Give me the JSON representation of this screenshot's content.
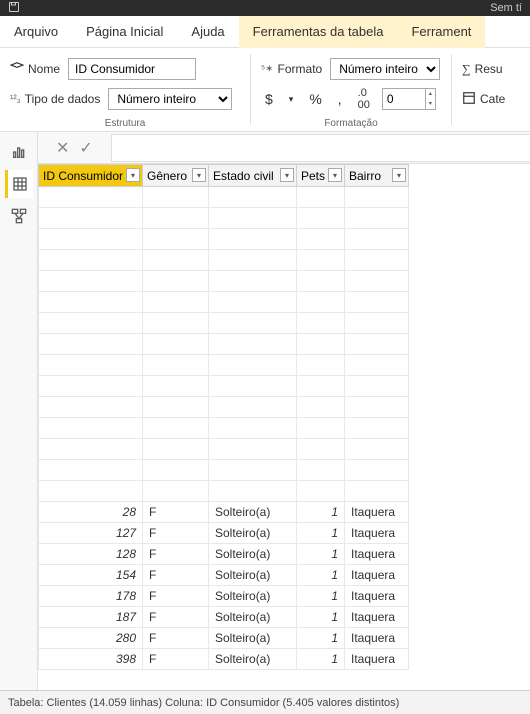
{
  "titlebar": {
    "right_text": "Sem tí"
  },
  "tabs": {
    "file": "Arquivo",
    "home": "Página Inicial",
    "help": "Ajuda",
    "table_tools": "Ferramentas da tabela",
    "col_tools": "Ferrament"
  },
  "ribbon": {
    "name_label": "Nome",
    "name_value": "ID Consumidor",
    "datatype_label": "Tipo de dados",
    "datatype_value": "Número inteiro",
    "structure_group": "Estrutura",
    "format_label": "Formato",
    "format_value": "Número inteiro",
    "decimal_value": "0",
    "format_group": "Formatação",
    "sum_label": "Resu",
    "cat_label": "Cate",
    "dollar": "$",
    "percent": "%",
    "comma": ","
  },
  "columns": {
    "id": "ID Consumidor",
    "genero": "Gênero",
    "estado": "Estado civil",
    "pets": "Pets",
    "bairro": "Bairro"
  },
  "chart_data": {
    "type": "table",
    "columns": [
      "ID Consumidor",
      "Gênero",
      "Estado civil",
      "Pets",
      "Bairro"
    ],
    "rows": [
      {
        "id": 28,
        "genero": "F",
        "estado": "Solteiro(a)",
        "pets": 1,
        "bairro": "Itaquera"
      },
      {
        "id": 127,
        "genero": "F",
        "estado": "Solteiro(a)",
        "pets": 1,
        "bairro": "Itaquera"
      },
      {
        "id": 128,
        "genero": "F",
        "estado": "Solteiro(a)",
        "pets": 1,
        "bairro": "Itaquera"
      },
      {
        "id": 154,
        "genero": "F",
        "estado": "Solteiro(a)",
        "pets": 1,
        "bairro": "Itaquera"
      },
      {
        "id": 178,
        "genero": "F",
        "estado": "Solteiro(a)",
        "pets": 1,
        "bairro": "Itaquera"
      },
      {
        "id": 187,
        "genero": "F",
        "estado": "Solteiro(a)",
        "pets": 1,
        "bairro": "Itaquera"
      },
      {
        "id": 280,
        "genero": "F",
        "estado": "Solteiro(a)",
        "pets": 1,
        "bairro": "Itaquera"
      },
      {
        "id": 398,
        "genero": "F",
        "estado": "Solteiro(a)",
        "pets": 1,
        "bairro": "Itaquera"
      }
    ]
  },
  "status": "Tabela: Clientes (14.059 linhas) Coluna: ID Consumidor (5.405 valores distintos)"
}
